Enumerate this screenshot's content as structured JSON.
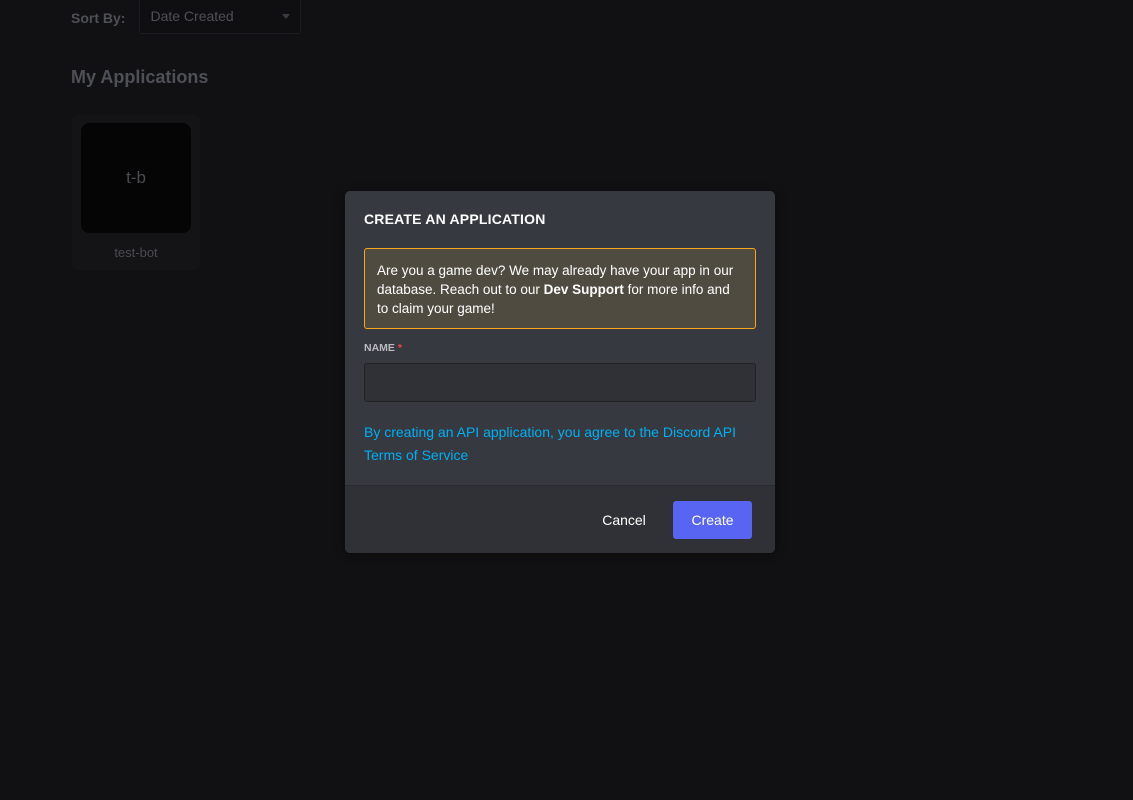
{
  "background": {
    "sort_label": "Sort By:",
    "sort_value": "Date Created",
    "section_title": "My Applications",
    "apps": [
      {
        "initials": "t-b",
        "name": "test-bot"
      }
    ]
  },
  "modal": {
    "title": "CREATE AN APPLICATION",
    "notice": {
      "text_before": "Are you a game dev? We may already have your app in our database. Reach out to our ",
      "bold": "Dev Support",
      "text_after": " for more info and to claim your game!",
      "border_color": "#faa61a"
    },
    "name_field": {
      "label": "NAME",
      "required_marker": "*",
      "value": "",
      "placeholder": ""
    },
    "tos_link": "By creating an API application, you agree to the Discord API Terms of Service",
    "cancel_label": "Cancel",
    "create_label": "Create"
  },
  "colors": {
    "accent": "#5865f2",
    "link": "#00b0f4",
    "required": "#f04747"
  }
}
